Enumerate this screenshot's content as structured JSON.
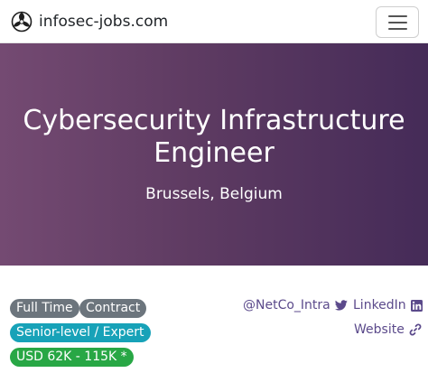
{
  "navbar": {
    "brand_name": "infosec-jobs.com",
    "logo_icon": "infosec-jobs-logo-icon",
    "menu_icon": "hamburger-menu-icon"
  },
  "hero": {
    "title": "Cybersecurity Infrastructure Engineer",
    "location": "Brussels, Belgium"
  },
  "badges": {
    "full_time": "Full Time",
    "contract": "Contract",
    "seniority": "Senior-level / Expert",
    "salary": "USD 62K - 115K *"
  },
  "links": {
    "twitter": "@NetCo_Intra",
    "linkedin": "LinkedIn",
    "website": "Website"
  },
  "colors": {
    "hero_gradient_start": "#744a72",
    "hero_gradient_end": "#452b58",
    "link": "#5b4a8b",
    "badge_secondary": "#6c757d",
    "badge_info": "#17a2b8",
    "badge_success": "#28a745"
  }
}
